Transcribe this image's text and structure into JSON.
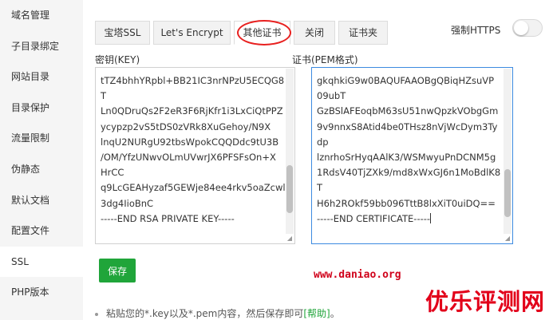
{
  "sidebar": {
    "items": [
      {
        "label": "域名管理"
      },
      {
        "label": "子目录绑定"
      },
      {
        "label": "网站目录"
      },
      {
        "label": "目录保护"
      },
      {
        "label": "流量限制"
      },
      {
        "label": "伪静态"
      },
      {
        "label": "默认文档"
      },
      {
        "label": "配置文件"
      },
      {
        "label": "SSL"
      },
      {
        "label": "PHP版本"
      }
    ],
    "active": "SSL"
  },
  "tabs": [
    {
      "label": "宝塔SSL"
    },
    {
      "label": "Let's Encrypt"
    },
    {
      "label": "其他证书"
    },
    {
      "label": "关闭"
    },
    {
      "label": "证书夹"
    }
  ],
  "active_tab": "其他证书",
  "force_https": {
    "label": "强制HTTPS",
    "enabled": false
  },
  "key_panel": {
    "label": "密钥(KEY)",
    "lines": [
      "tTZ4bhhYRpbl+BB21IC3nrNPzU5ECQG8",
      "T",
      "Ln0QDruQs2F2eR3F6RjKfr1i3LxCiQtPPZ",
      "ycypzp2vS5tDS0zVRk8XuGehoy/N9X",
      "lnqU2NURgU92tbsWpokCQQDdc9tU3B",
      "/OM/YfzUNwvOLmUVwrJX6PFSFsOn+X",
      "HrCC",
      "q9LcGEAHyzaf5GEWje84ee4rkv5oaZcwll",
      "3dg4IioBnC",
      "-----END RSA PRIVATE KEY-----"
    ],
    "scroll_position": 0.82
  },
  "cert_panel": {
    "label": "证书(PEM格式)",
    "lines": [
      "gkqhkiG9w0BAQUFAAOBgQBiqHZsuVP",
      "09ubT",
      "GzBSlAFEoqbM63sU51nwQpzkVObgGm",
      "9v9nnxS8Atid4be0THsz8nVjWcDym3Ty",
      "dp",
      "lznrhoSrHyqAAlK3/WSMwyuPnDCNM5g",
      "1RdsV40TjZXk9/md8xWxGJ6n1MoBdlK8",
      "T",
      "H6h2ROkf59bb096TttB8lxXiT0uiDQ==",
      "-----END CERTIFICATE-----"
    ],
    "scroll_position": 0.85
  },
  "save_label": "保存",
  "watermark_url": "www.daniao.org",
  "watermark_brand": "优乐评测网",
  "hint": {
    "text": "粘贴您的*.key以及*.pem内容，然后保存即可",
    "link": "[帮助]",
    "suffix": "。"
  },
  "colors": {
    "accent": "#20a53a",
    "focus": "#3c8ae0",
    "annotation": "#e8201f"
  }
}
